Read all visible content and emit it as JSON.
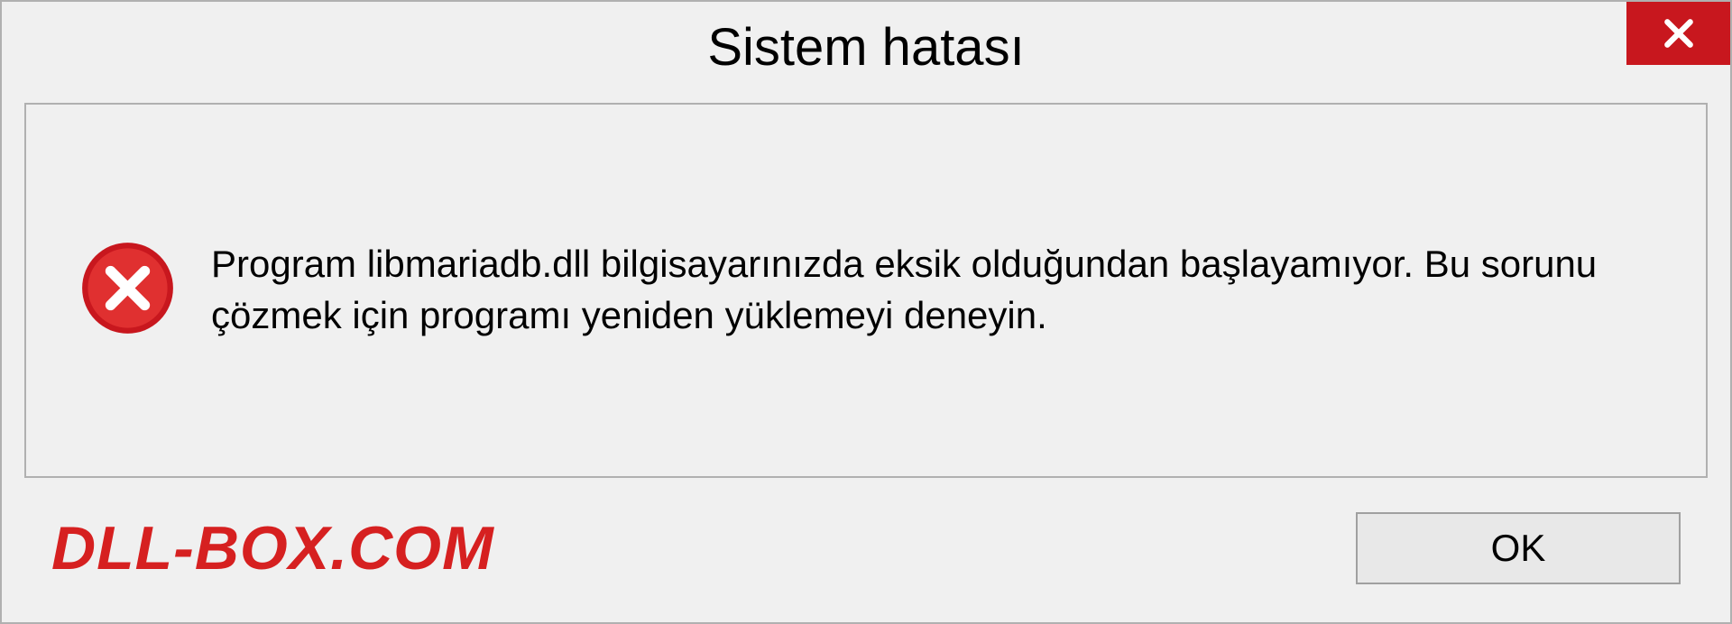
{
  "titlebar": {
    "title": "Sistem hatası"
  },
  "content": {
    "message": "Program libmariadb.dll bilgisayarınızda eksik olduğundan başlayamıyor. Bu sorunu çözmek için programı yeniden yüklemeyi deneyin."
  },
  "footer": {
    "watermark": "DLL-BOX.COM",
    "ok_label": "OK"
  }
}
